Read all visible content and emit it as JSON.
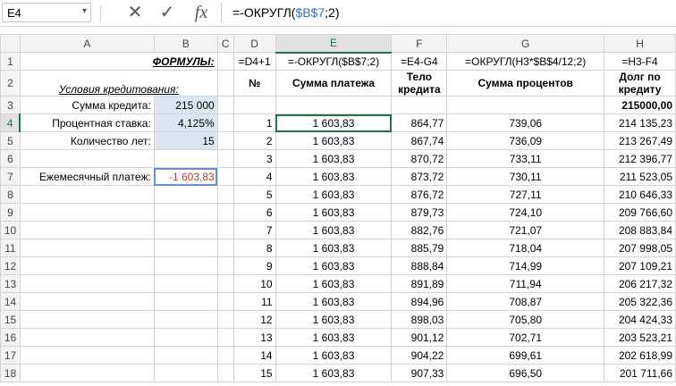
{
  "namebox": {
    "value": "E4",
    "dropdown": "▾"
  },
  "formula_bar": {
    "prefix": "=-ОКРУГЛ(",
    "ref": "$B$7",
    "suffix": ";2)"
  },
  "icons": {
    "cancel": "✕",
    "enter": "✓",
    "fx": "fx"
  },
  "columns": [
    "A",
    "B",
    "C",
    "D",
    "E",
    "F",
    "G",
    "H"
  ],
  "row1": {
    "a_label": "ФОРМУЛЫ:",
    "d": "=D4+1",
    "e": "=-ОКРУГЛ($B$7;2)",
    "f": "=E4-G4",
    "g": "=ОКРУГЛ(H3*$B$4/12;2)",
    "h": "=H3-F4"
  },
  "row2": {
    "a": "Условия кредитования:",
    "d": "№",
    "e": "Сумма платежа",
    "f": "Тело кредита",
    "g": "Сумма процентов",
    "h": "Долг по кредиту"
  },
  "row3": {
    "a": "Сумма кредита:",
    "b": "215 000",
    "h": "215000,00"
  },
  "row4": {
    "a": "Процентная ставка:",
    "b": "4,125%"
  },
  "row5": {
    "a": "Количество лет:",
    "b": "15"
  },
  "row7": {
    "a": "Ежемесячный платеж:",
    "b": "-1 603,83"
  },
  "row_numbers": [
    "1",
    "2",
    "3",
    "4",
    "5",
    "6",
    "7",
    "8",
    "9",
    "10",
    "11",
    "12",
    "13",
    "14",
    "15",
    "16",
    "17",
    "18"
  ],
  "schedule": [
    {
      "row": "4",
      "d": "1",
      "e": "1 603,83",
      "f": "864,77",
      "g": "739,06",
      "h": "214 135,23"
    },
    {
      "row": "5",
      "d": "2",
      "e": "1 603,83",
      "f": "867,74",
      "g": "736,09",
      "h": "213 267,49"
    },
    {
      "row": "6",
      "d": "3",
      "e": "1 603,83",
      "f": "870,72",
      "g": "733,11",
      "h": "212 396,77"
    },
    {
      "row": "7",
      "d": "4",
      "e": "1 603,83",
      "f": "873,72",
      "g": "730,11",
      "h": "211 523,05"
    },
    {
      "row": "8",
      "d": "5",
      "e": "1 603,83",
      "f": "876,72",
      "g": "727,11",
      "h": "210 646,33"
    },
    {
      "row": "9",
      "d": "6",
      "e": "1 603,83",
      "f": "879,73",
      "g": "724,10",
      "h": "209 766,60"
    },
    {
      "row": "10",
      "d": "7",
      "e": "1 603,83",
      "f": "882,76",
      "g": "721,07",
      "h": "208 883,84"
    },
    {
      "row": "11",
      "d": "8",
      "e": "1 603,83",
      "f": "885,79",
      "g": "718,04",
      "h": "207 998,05"
    },
    {
      "row": "12",
      "d": "9",
      "e": "1 603,83",
      "f": "888,84",
      "g": "714,99",
      "h": "207 109,21"
    },
    {
      "row": "13",
      "d": "10",
      "e": "1 603,83",
      "f": "891,89",
      "g": "711,94",
      "h": "206 217,32"
    },
    {
      "row": "14",
      "d": "11",
      "e": "1 603,83",
      "f": "894,96",
      "g": "708,87",
      "h": "205 322,36"
    },
    {
      "row": "15",
      "d": "12",
      "e": "1 603,83",
      "f": "898,03",
      "g": "705,80",
      "h": "204 424,33"
    },
    {
      "row": "16",
      "d": "13",
      "e": "1 603,83",
      "f": "901,12",
      "g": "702,71",
      "h": "203 523,21"
    },
    {
      "row": "17",
      "d": "14",
      "e": "1 603,83",
      "f": "904,22",
      "g": "699,61",
      "h": "202 618,99"
    },
    {
      "row": "18",
      "d": "15",
      "e": "1 603,83",
      "f": "907,33",
      "g": "696,50",
      "h": "201 711,66"
    }
  ]
}
